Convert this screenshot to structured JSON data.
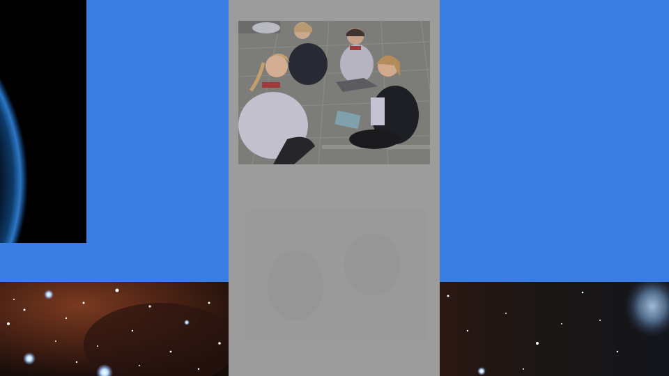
{
  "slide": {
    "background_color": "#3a7de3",
    "panel_color": "#9c9c9c"
  },
  "images": {
    "earth_icon": "earth-horizon-icon",
    "nebula_icon": "starfield-nebula-icon",
    "photo_icon": "group-photo-icon"
  }
}
